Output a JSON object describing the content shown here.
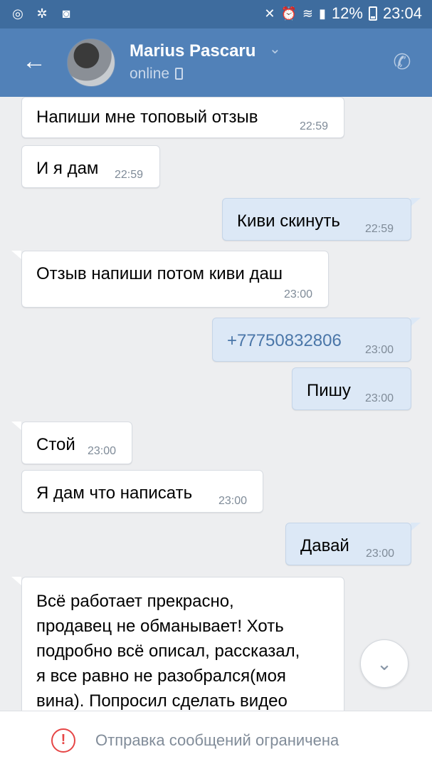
{
  "status_bar": {
    "battery": "12%",
    "time": "23:04"
  },
  "header": {
    "contact_name": "Marius Pascaru",
    "presence": "online"
  },
  "messages": [
    {
      "direction": "in",
      "text": "Напиши мне топовый отзыв",
      "time": "22:59"
    },
    {
      "direction": "in",
      "text": "И я дам",
      "time": "22:59"
    },
    {
      "direction": "out",
      "text": "Киви скинуть",
      "time": "22:59"
    },
    {
      "direction": "in",
      "text": "Отзыв напиши потом киви даш",
      "time": "23:00"
    },
    {
      "direction": "out",
      "text": "+77750832806",
      "time": "23:00"
    },
    {
      "direction": "out",
      "text": "Пишу",
      "time": "23:00"
    },
    {
      "direction": "in",
      "text": "Стой",
      "time": "23:00"
    },
    {
      "direction": "in",
      "text": "Я дам что написать",
      "time": "23:00"
    },
    {
      "direction": "out",
      "text": "Давай",
      "time": "23:00"
    },
    {
      "direction": "in",
      "lines": [
        "Всё работает прекрасно,",
        "продавец не обманывает! Хоть",
        "подробно всё описал, рассказал,",
        "я все равно не разобрался(моя",
        "вина). Попросил сделать видео"
      ]
    }
  ],
  "footer": {
    "restriction_text": "Отправка сообщений ограничена"
  },
  "colors": {
    "header": "#5181b8",
    "status_bar": "#3e6c9e",
    "outgoing_bubble": "#dce8f6",
    "incoming_bubble": "#ffffff",
    "background": "#edeef0",
    "warning": "#e64646"
  },
  "icons": [
    "shazam-icon",
    "network-icon",
    "app-notification-icon",
    "mute-icon",
    "alarm-icon",
    "wifi-icon",
    "signal-icon",
    "battery-icon",
    "back-arrow-icon",
    "chevron-down-icon",
    "phone-icon",
    "mobile-presence-icon",
    "scroll-down-icon",
    "warning-icon"
  ]
}
